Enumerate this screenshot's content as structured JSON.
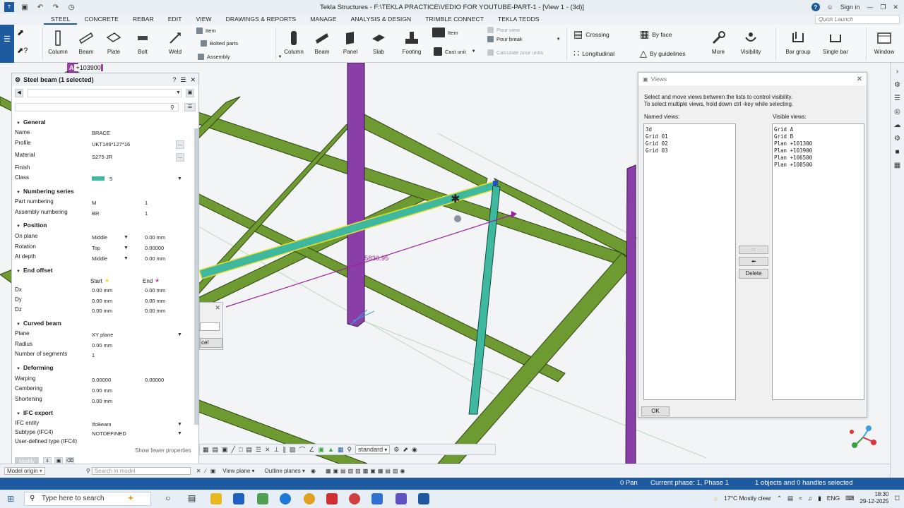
{
  "window": {
    "title": "Tekla Structures - F:\\TEKLA PRACTICE\\VEDIO FOR YOUTUBE-PART-1 - [View 1 - (3d)]",
    "sign_in": "Sign in"
  },
  "menu": {
    "tabs": [
      "STEEL",
      "CONCRETE",
      "REBAR",
      "EDIT",
      "VIEW",
      "DRAWINGS & REPORTS",
      "MANAGE",
      "ANALYSIS & DESIGN",
      "TRIMBLE CONNECT",
      "TEKLA TEDDS"
    ],
    "active_tab": "STEEL",
    "quick_launch_placeholder": "Quick Launch"
  },
  "ribbon": {
    "steel": {
      "column": "Column",
      "beam": "Beam",
      "plate": "Plate",
      "bolt": "Bolt",
      "weld": "Weld",
      "item": "Item",
      "bolted_parts": "Bolted parts",
      "assembly": "Assembly"
    },
    "concrete": {
      "column": "Column",
      "beam": "Beam",
      "panel": "Panel",
      "slab": "Slab",
      "footing": "Footing",
      "item": "Item",
      "cast_unit": "Cast unit",
      "pour_view": "Pour view",
      "pour_break": "Pour break",
      "calculate_pour_units": "Calculate pour units"
    },
    "rebar": {
      "crossing": "Crossing",
      "by_face": "By face",
      "longitudinal": "Longitudinal",
      "by_guidelines": "By guidelines",
      "more": "More",
      "visibility": "Visibility",
      "bar_group": "Bar group",
      "single_bar": "Single bar",
      "window": "Window"
    }
  },
  "viewport": {
    "grid_label_prefix": "A",
    "grid_label": "+103900",
    "dimension": "5830.95"
  },
  "properties": {
    "title": "Steel beam (1 selected)",
    "sections": {
      "general": "General",
      "numbering": "Numbering series",
      "position": "Position",
      "end_offset": "End offset",
      "curved": "Curved beam",
      "deforming": "Deforming",
      "ifc": "IFC export"
    },
    "general": {
      "name_label": "Name",
      "name": "BRACE",
      "profile_label": "Profile",
      "profile": "UKT146*127*16",
      "material_label": "Material",
      "material": "S275-JR",
      "finish_label": "Finish",
      "finish": "",
      "class_label": "Class",
      "class": "5"
    },
    "numbering": {
      "part_label": "Part numbering",
      "part_prefix": "M",
      "part_start": "1",
      "assembly_label": "Assembly numbering",
      "assembly_prefix": "BR",
      "assembly_start": "1"
    },
    "position": {
      "on_plane_label": "On plane",
      "on_plane": "Middle",
      "on_plane_val": "0.00 mm",
      "rotation_label": "Rotation",
      "rotation": "Top",
      "rotation_val": "0.00000",
      "at_depth_label": "At depth",
      "at_depth": "Middle",
      "at_depth_val": "0.00 mm"
    },
    "end_offset": {
      "start_label": "Start",
      "end_label": "End",
      "dx_label": "Dx",
      "dx_start": "0.00 mm",
      "dx_end": "0.00 mm",
      "dy_label": "Dy",
      "dy_start": "0.00 mm",
      "dy_end": "0.00 mm",
      "dz_label": "Dz",
      "dz_start": "0.00 mm",
      "dz_end": "0.00 mm"
    },
    "curved": {
      "plane_label": "Plane",
      "plane": "XY plane",
      "radius_label": "Radius",
      "radius": "0.00 mm",
      "segments_label": "Number of segments",
      "segments": "1"
    },
    "deforming": {
      "warping_label": "Warping",
      "warping_start": "0.00000",
      "warping_end": "0.00000",
      "cambering_label": "Cambering",
      "cambering": "0.00 mm",
      "shortening_label": "Shortening",
      "shortening": "0.00 mm"
    },
    "ifc": {
      "entity_label": "IFC entity",
      "entity": "IfcBeam",
      "subtype_label": "Subtype (IFC4)",
      "subtype": "NOTDEFINED",
      "user_type_label": "User-defined type (IFC4)"
    },
    "show_fewer": "Show fewer properties",
    "modify": "Modify"
  },
  "views_dialog": {
    "title": "Views",
    "info_line1": "Select and move views between the lists to control visibility.",
    "info_line2": "To select multiple views, hold down ctrl -key while selecting.",
    "named_label": "Named views:",
    "visible_label": "Visible views:",
    "named_views": [
      "3d",
      "Grid 01",
      "Grid 02",
      "Grid 03"
    ],
    "visible_views": [
      "Grid A",
      "Grid B",
      "Plan +101300",
      "Plan +103900",
      "Plan +106500",
      "Plan +108500"
    ],
    "delete": "Delete",
    "ok": "OK"
  },
  "fragment": {
    "partial_label": "cel"
  },
  "snapbar": {
    "standard": "standard"
  },
  "viewbar": {
    "model_origin": "Model origin",
    "search": "Search in model",
    "view_plane": "View plane",
    "outline_planes": "Outline planes"
  },
  "status": {
    "pan": "0 Pan",
    "phase": "Current phase: 1, Phase 1",
    "selection": "1 objects and 0 handles selected"
  },
  "taskbar": {
    "search": "Type here to search",
    "weather": "17°C  Mostly clear",
    "lang": "ENG",
    "time": "18:30",
    "date": "29-12-2025"
  },
  "colors": {
    "accent": "#1e5aa0",
    "steel_green": "#6e9a32",
    "column_purple": "#8a3fa8",
    "brace_teal": "#3fb8a0",
    "dimension_magenta": "#a020a0"
  }
}
